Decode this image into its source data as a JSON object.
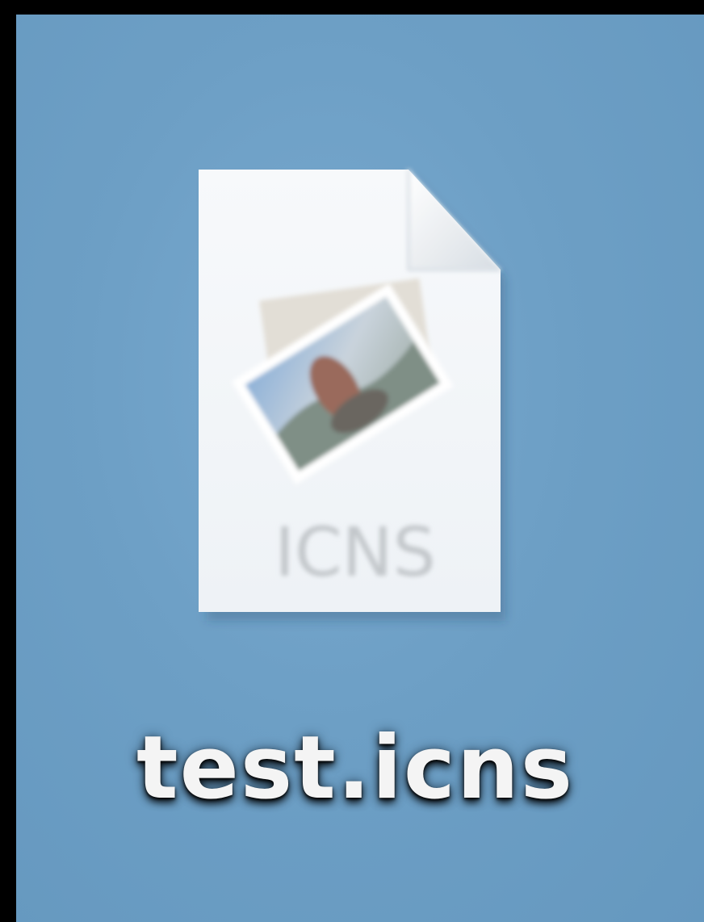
{
  "desktop": {
    "background_color": "#6d9fc5",
    "file": {
      "name": "test.icns",
      "icon": "icns-document-icon",
      "icon_badge_text": "ICNS",
      "preview_icon": "photo-preview-icon"
    }
  }
}
